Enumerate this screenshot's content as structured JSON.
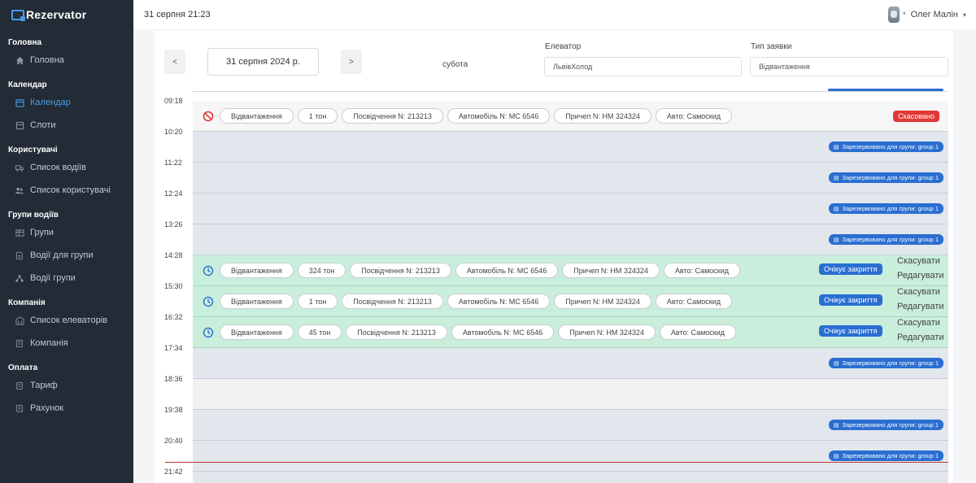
{
  "brand": {
    "name": "Rezervator"
  },
  "header": {
    "datetime": "31 серпня 21:23",
    "user_name": "Олег Малін",
    "badge": "*"
  },
  "sidebar": {
    "sections": [
      {
        "title": "Головна",
        "items": [
          {
            "label": "Головна",
            "icon": "home-icon"
          }
        ]
      },
      {
        "title": "Календар",
        "items": [
          {
            "label": "Календар",
            "icon": "calendar-icon",
            "active": true
          },
          {
            "label": "Слоти",
            "icon": "slots-icon"
          }
        ]
      },
      {
        "title": "Користувачі",
        "items": [
          {
            "label": "Список водіїв",
            "icon": "truck-icon"
          },
          {
            "label": "Список користувачі",
            "icon": "users-icon"
          }
        ]
      },
      {
        "title": "Групи водіїв",
        "items": [
          {
            "label": "Групи",
            "icon": "groups-icon"
          },
          {
            "label": "Водії для групи",
            "icon": "document-icon"
          },
          {
            "label": "Водії групи",
            "icon": "network-icon"
          }
        ]
      },
      {
        "title": "Компанія",
        "items": [
          {
            "label": "Список елеваторів",
            "icon": "building-icon"
          },
          {
            "label": "Компанія",
            "icon": "company-icon"
          }
        ]
      },
      {
        "title": "Оплата",
        "items": [
          {
            "label": "Тариф",
            "icon": "tariff-icon"
          },
          {
            "label": "Рахунок",
            "icon": "invoice-icon"
          }
        ]
      }
    ]
  },
  "filters": {
    "prev_label": "<",
    "next_label": ">",
    "date": "31 серпня 2024 р.",
    "weekday": "субота",
    "elevator_label": "Елеватор",
    "elevator_value": "ЛьвівХолод",
    "type_label": "Тип заявки",
    "type_value": "Відвантаження"
  },
  "times": [
    "09:18",
    "10:20",
    "11:22",
    "12:24",
    "13:26",
    "14:28",
    "15:30",
    "16:32",
    "17:34",
    "18:36",
    "19:38",
    "20:40",
    "21:42"
  ],
  "reserved_label": "Зарезервовано для групи: group 1",
  "cancelled_booking": {
    "pills": [
      "Відвантаження",
      "1 тон",
      "Посвідчення N: 213213",
      "Автомобіль N: MC 6546",
      "Причеп N: HM 324324",
      "Авто: Самоскид"
    ],
    "status": "Скасовано"
  },
  "active_bookings": [
    {
      "pills": [
        "Відвантаження",
        "324 тон",
        "Посвідчення N: 213213",
        "Автомобіль N: MC 6546",
        "Причеп N: HM 324324",
        "Авто: Самоскид"
      ],
      "status": "Очікує закриття",
      "cancel": "Скасувати",
      "edit": "Редагувати"
    },
    {
      "pills": [
        "Відвантаження",
        "1 тон",
        "Посвідчення N: 213213",
        "Автомобіль N: MC 6546",
        "Причеп N: HM 324324",
        "Авто: Самоскид"
      ],
      "status": "Очікує закриття",
      "cancel": "Скасувати",
      "edit": "Редагувати"
    },
    {
      "pills": [
        "Відвантаження",
        "45 тон",
        "Посвідчення N: 213213",
        "Автомобіль N: MC 6546",
        "Причеп N: HM 324324",
        "Авто: Самоскид"
      ],
      "status": "Очікує закриття",
      "cancel": "Скасувати",
      "edit": "Редагувати"
    }
  ],
  "colors": {
    "sidebar_bg": "#222b36",
    "accent": "#4a9be8",
    "reserved": "#2a6ed1",
    "cancelled": "#e03838",
    "active_row": "#c9efdc"
  }
}
